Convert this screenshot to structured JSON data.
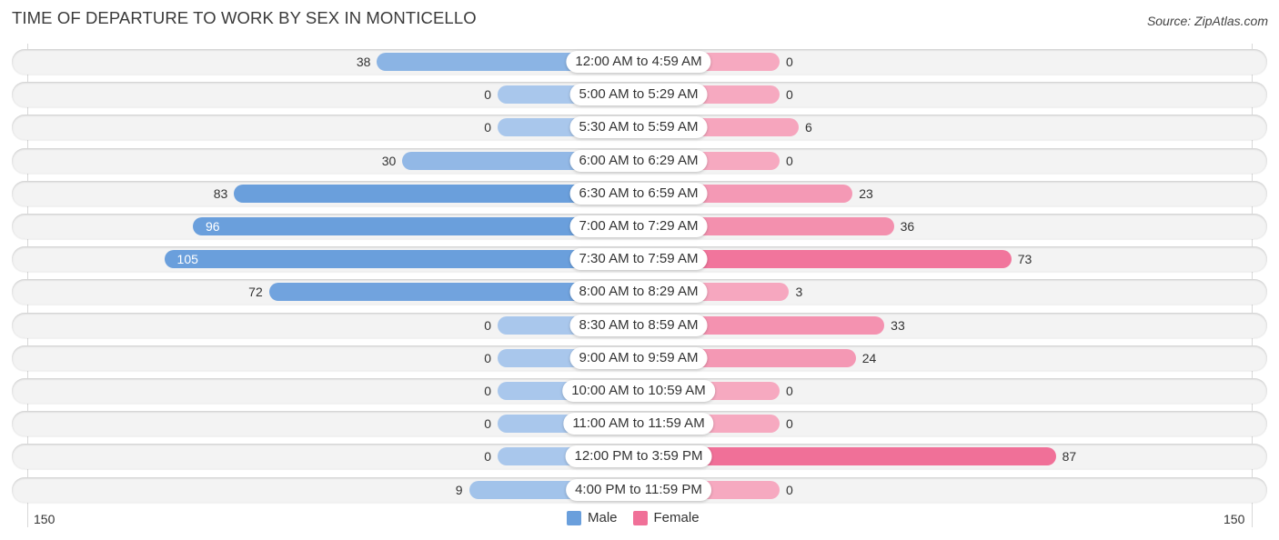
{
  "title": "TIME OF DEPARTURE TO WORK BY SEX IN MONTICELLO",
  "source": "Source: ZipAtlas.com",
  "colors": {
    "male": "#6a9fdc",
    "female": "#f07098",
    "male_light": "#a9c7ec",
    "female_light": "#f6a9c0"
  },
  "chart_data": {
    "type": "bar",
    "orientation": "horizontal-diverging",
    "title": "TIME OF DEPARTURE TO WORK BY SEX IN MONTICELLO",
    "categories": [
      "12:00 AM to 4:59 AM",
      "5:00 AM to 5:29 AM",
      "5:30 AM to 5:59 AM",
      "6:00 AM to 6:29 AM",
      "6:30 AM to 6:59 AM",
      "7:00 AM to 7:29 AM",
      "7:30 AM to 7:59 AM",
      "8:00 AM to 8:29 AM",
      "8:30 AM to 8:59 AM",
      "9:00 AM to 9:59 AM",
      "10:00 AM to 10:59 AM",
      "11:00 AM to 11:59 AM",
      "12:00 PM to 3:59 PM",
      "4:00 PM to 11:59 PM"
    ],
    "series": [
      {
        "name": "Male",
        "values": [
          38,
          0,
          0,
          30,
          83,
          96,
          105,
          72,
          0,
          0,
          0,
          0,
          0,
          9
        ]
      },
      {
        "name": "Female",
        "values": [
          0,
          0,
          6,
          0,
          23,
          36,
          73,
          3,
          33,
          24,
          0,
          0,
          87,
          0
        ]
      }
    ],
    "xlim": [
      -150,
      150
    ],
    "axis_tick_labels": {
      "left": "150",
      "right": "150"
    },
    "legend": {
      "placement": "bottom-center",
      "entries": [
        "Male",
        "Female"
      ]
    },
    "grid": false
  }
}
